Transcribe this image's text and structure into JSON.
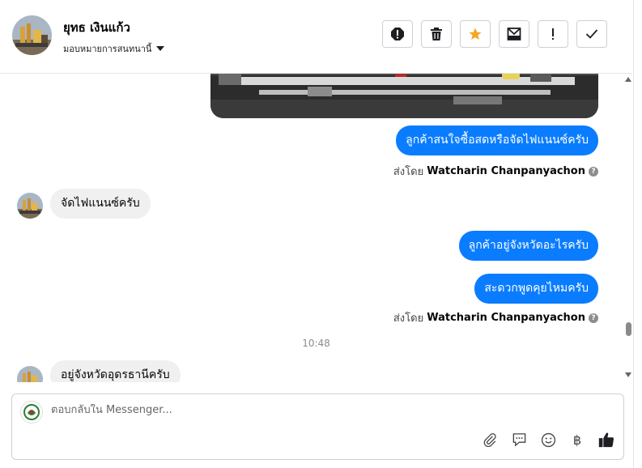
{
  "header": {
    "contact_name": "ยุทธ เงินแก้ว",
    "assign_label": "มอบหมายการสนทนานี้",
    "action_icons": [
      "spam-report-icon",
      "trash-icon",
      "star-icon",
      "mark-unread-icon",
      "important-icon",
      "done-check-icon"
    ]
  },
  "thread": {
    "messages": [
      {
        "direction": "out",
        "text": "ลูกค้าสนใจซื้อสดหรือจัดไฟแนนซ์ครับ"
      },
      {
        "sent_by_prefix": "ส่งโดย",
        "sent_by_name": "Watcharin Chanpanyachon"
      },
      {
        "direction": "in",
        "text": "จัดไฟแนนซ์ครับ"
      },
      {
        "direction": "out",
        "text": "ลูกค้าอยู่จังหวัดอะไรครับ"
      },
      {
        "direction": "out",
        "text": "สะดวกพูดคุยไหมครับ"
      },
      {
        "sent_by_prefix": "ส่งโดย",
        "sent_by_name": "Watcharin Chanpanyachon"
      },
      {
        "timestamp": "10:48"
      },
      {
        "direction": "in",
        "text": "อยู่จังหวัดอุดรธานีครับ"
      }
    ]
  },
  "composer": {
    "placeholder": "ตอบกลับใน Messenger...",
    "value": "",
    "tool_icons": [
      "attachment-icon",
      "saved-reply-icon",
      "emoji-icon",
      "baht-payment-icon",
      "thumbs-up-icon"
    ],
    "baht_symbol": "฿"
  },
  "colors": {
    "outgoing_bubble": "#0a7cff",
    "incoming_bubble": "#f0f0f0",
    "star_accent": "#f5a623"
  }
}
